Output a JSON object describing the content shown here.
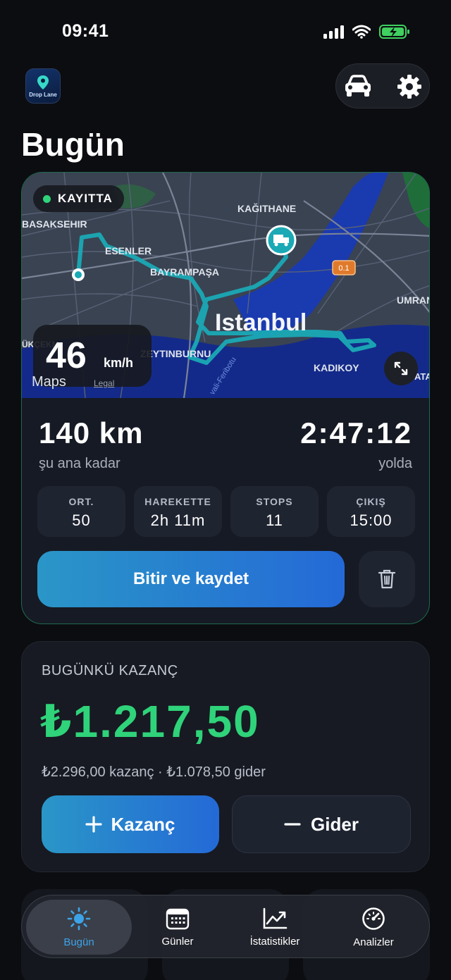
{
  "status_bar": {
    "time": "09:41"
  },
  "header": {
    "logo_text": "Drop Lane",
    "title": "Bugün"
  },
  "trip": {
    "recording_label": "KAYITTA",
    "map_labels": [
      "BASAKSEHIR",
      "ESENLER",
      "BAYRAMPAŞA",
      "KAĞITHANE",
      "Istanbul",
      "ZEYTINBURNU",
      "KADIKOY",
      "UMRAN",
      "ÜKÇEKM",
      "ATA",
      "0.1",
      "vali-Feribotu"
    ],
    "speed": "46",
    "speed_unit": "km/h",
    "maps_attribution": "Maps",
    "legal": "Legal",
    "distance": "140 km",
    "distance_sub": "şu ana kadar",
    "duration": "2:47:12",
    "duration_sub": "yolda",
    "stats": [
      {
        "label": "ORT.",
        "value": "50"
      },
      {
        "label": "HAREKETTE",
        "value": "2h 11m"
      },
      {
        "label": "STOPS",
        "value": "11"
      },
      {
        "label": "ÇIKIŞ",
        "value": "15:00"
      }
    ],
    "finish_label": "Bitir ve kaydet"
  },
  "earnings": {
    "title": "BUGÜNKÜ KAZANÇ",
    "amount": "₺1.217,50",
    "breakdown": "₺2.296,00 kazanç · ₺1.078,50 gider",
    "add_earning": "Kazanç",
    "add_expense": "Gider"
  },
  "tabs": [
    {
      "label": "Bugün",
      "icon": "sun-icon",
      "active": true
    },
    {
      "label": "Günler",
      "icon": "calendar-icon",
      "active": false
    },
    {
      "label": "İstatistikler",
      "icon": "chart-icon",
      "active": false
    },
    {
      "label": "Analizler",
      "icon": "gauge-icon",
      "active": false
    }
  ],
  "colors": {
    "accent_green": "#2fd37a",
    "accent_blue": "#2469d7",
    "active_tab": "#3da3e8"
  }
}
